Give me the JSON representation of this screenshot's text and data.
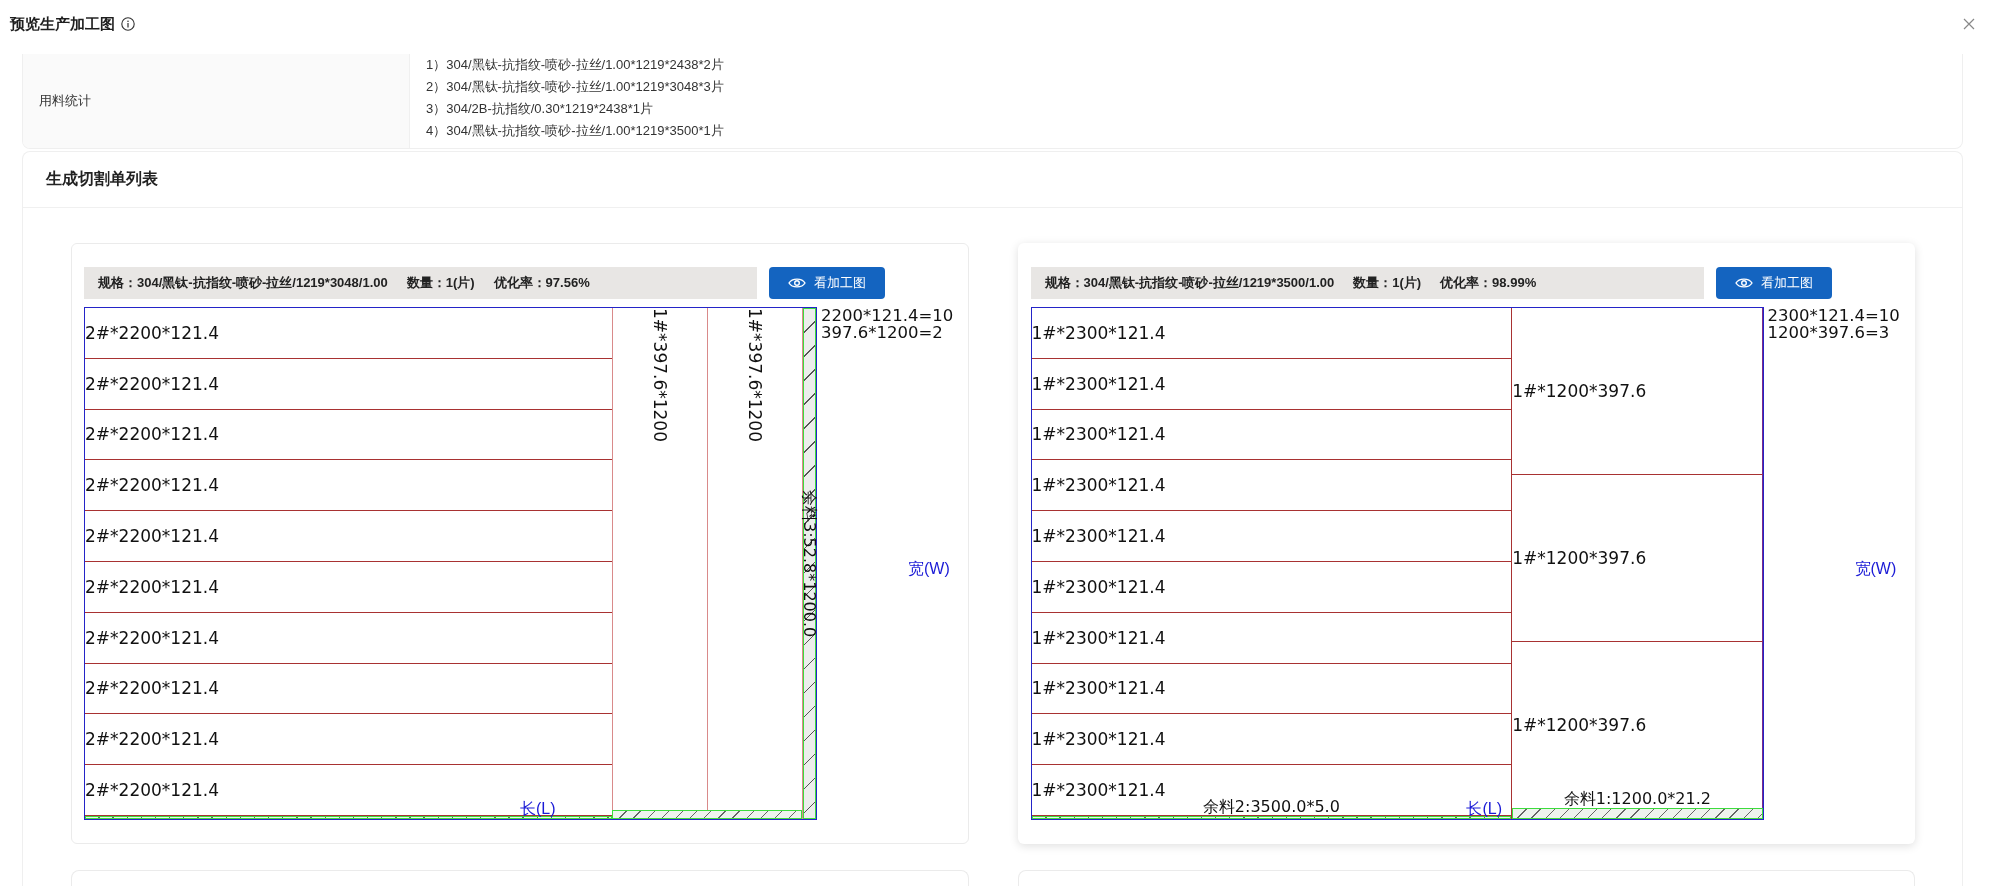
{
  "window": {
    "title": "预览生产加工图"
  },
  "material_stats": {
    "label": "用料统计",
    "lines": [
      "1）304/黑钛-抗指纹-喷砂-拉丝/1.00*1219*2438*2片",
      "2）304/黑钛-抗指纹-喷砂-拉丝/1.00*1219*3048*3片",
      "3）304/2B-抗指纹/0.30*1219*2438*1片",
      "4）304/黑钛-抗指纹-喷砂-拉丝/1.00*1219*3500*1片"
    ]
  },
  "cutting_list": {
    "title": "生成切割单列表",
    "cards": [
      {
        "kind": "sheet",
        "raised": false,
        "spec": "规格：304/黑钛-抗指纹-喷砂-拉丝/1219*3048/1.00",
        "quantity": "数量：1(片)",
        "rate": "优化率：97.56%",
        "button": "看加工图",
        "legend": [
          "2200*121.4=10",
          "397.6*1200=2"
        ],
        "length_label": "长(L)",
        "width_label": "宽(W)",
        "groups": [
          {
            "kind": "stack",
            "pieces": [
              "2#*2200*121.4",
              "2#*2200*121.4",
              "2#*2200*121.4",
              "2#*2200*121.4",
              "2#*2200*121.4",
              "2#*2200*121.4",
              "2#*2200*121.4",
              "2#*2200*121.4",
              "2#*2200*121.4",
              "2#*2200*121.4"
            ],
            "offcut": true
          },
          {
            "kind": "columns",
            "pieces": [
              "1#*397.6*1200",
              "1#*397.6*1200"
            ],
            "offcut": true
          },
          {
            "kind": "strip",
            "label": "余料3:52.8*1200.0"
          }
        ]
      },
      {
        "kind": "sheet",
        "raised": true,
        "spec": "规格：304/黑钛-抗指纹-喷砂-拉丝/1219*3500/1.00",
        "quantity": "数量：1(片)",
        "rate": "优化率：98.99%",
        "button": "看加工图",
        "legend": [
          "2300*121.4=10",
          "1200*397.6=3"
        ],
        "length_label": "长(L)",
        "width_label": "宽(W)",
        "groups": [
          {
            "kind": "stack",
            "pieces": [
              "1#*2300*121.4",
              "1#*2300*121.4",
              "1#*2300*121.4",
              "1#*2300*121.4",
              "1#*2300*121.4",
              "1#*2300*121.4",
              "1#*2300*121.4",
              "1#*2300*121.4",
              "1#*2300*121.4",
              "1#*2300*121.4"
            ],
            "offcut": true,
            "offcut_label": "余料2:3500.0*5.0"
          },
          {
            "kind": "stack",
            "pieces": [
              "1#*1200*397.6",
              "1#*1200*397.6",
              "1#*1200*397.6"
            ],
            "offcut": true,
            "offcut_label": "余料1:1200.0*21.2"
          }
        ]
      },
      {
        "kind": "clipped"
      },
      {
        "kind": "clipped"
      }
    ]
  }
}
